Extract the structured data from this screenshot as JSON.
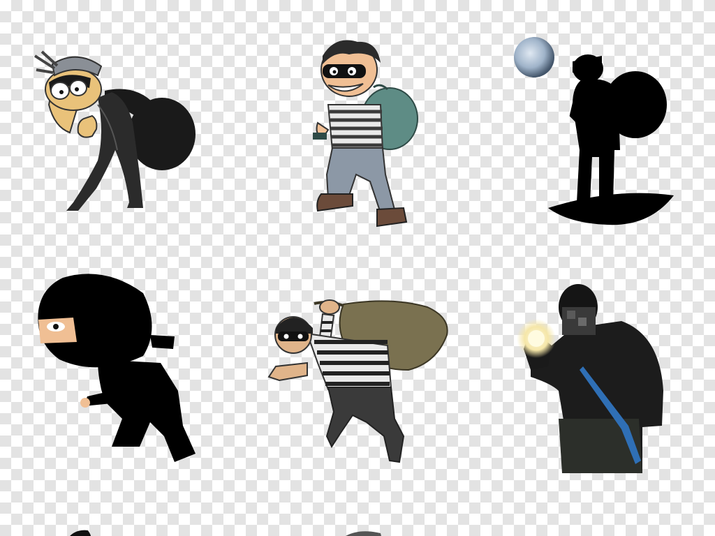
{
  "background": {
    "pattern": "transparency-checkerboard",
    "colors": [
      "#ffffff",
      "#e3e3e3"
    ]
  },
  "figures": [
    {
      "id": "thief-beanie-bag",
      "icon": "sneaking-thief-icon",
      "colors": [
        "#2b2b2b",
        "#e9c27a",
        "#8a8f96"
      ]
    },
    {
      "id": "thief-striped-green-bag",
      "icon": "grinning-thief-icon",
      "colors": [
        "#5e8c85",
        "#3b3b3b",
        "#8c98a6"
      ]
    },
    {
      "id": "thief-silhouette-moon",
      "icon": "silhouette-thief-icon",
      "colors": [
        "#000000",
        "#9fb3c9"
      ]
    },
    {
      "id": "ninja-thief",
      "icon": "ninja-icon",
      "colors": [
        "#000000",
        "#f0bf94"
      ]
    },
    {
      "id": "thief-striped-brown-bag",
      "icon": "burglar-with-sack-icon",
      "colors": [
        "#7a7150",
        "#222222",
        "#e0b48a"
      ]
    },
    {
      "id": "burglar-photo-flashlight",
      "icon": "burglar-flashlight-icon",
      "colors": [
        "#1c1c1c",
        "#f5e6a8",
        "#2f6fb5"
      ]
    },
    {
      "id": "partial-bottom-left",
      "icon": "partial-figure-icon",
      "colors": [
        "#111111"
      ]
    },
    {
      "id": "partial-bottom-center",
      "icon": "partial-figure-icon",
      "colors": [
        "#555555"
      ]
    }
  ]
}
